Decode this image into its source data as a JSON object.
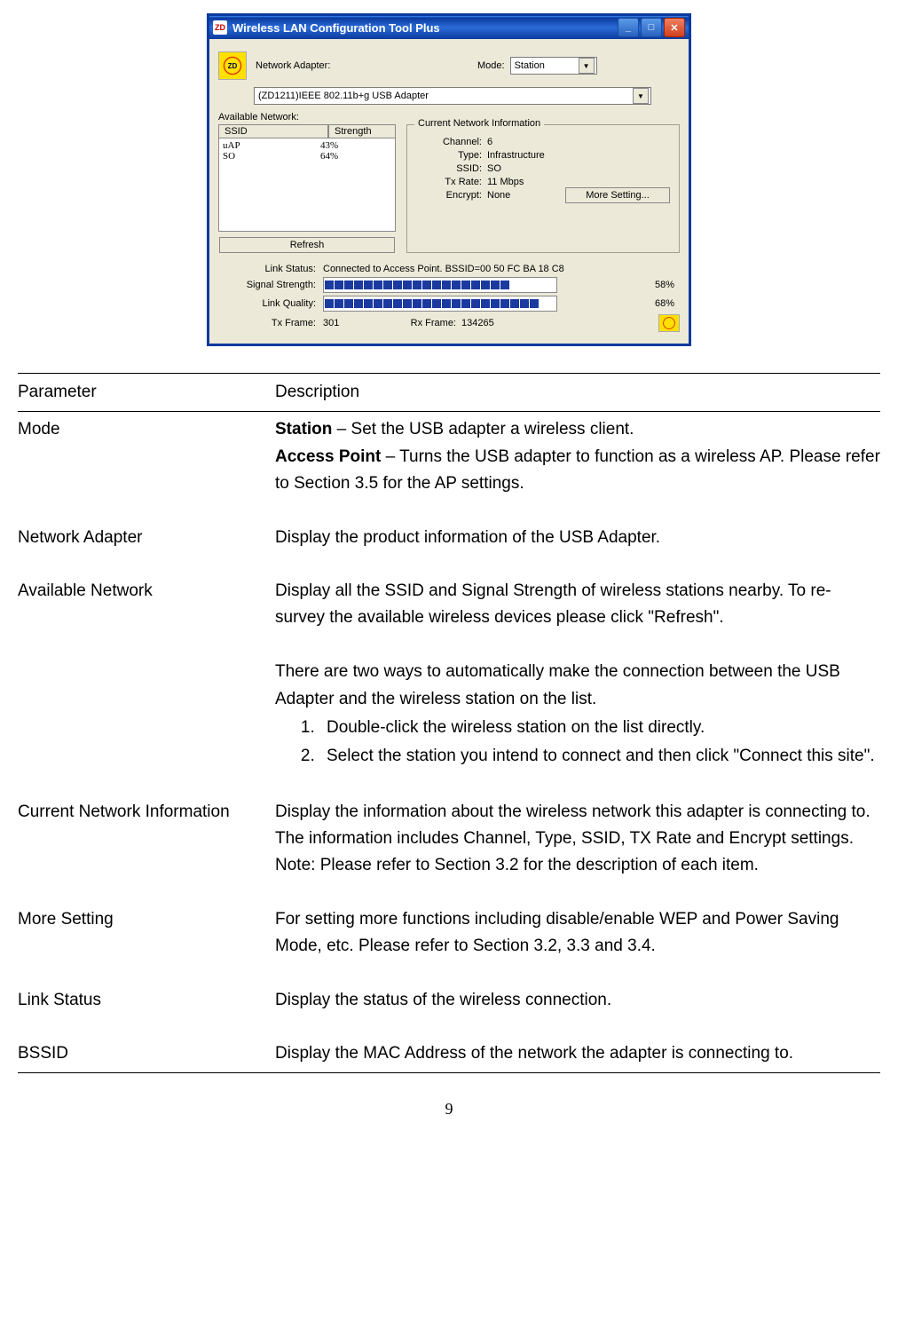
{
  "window": {
    "title": "Wireless LAN Configuration Tool Plus",
    "network_adapter_label": "Network Adapter:",
    "mode_label": "Mode:",
    "mode_value": "Station",
    "adapter_value": "(ZD1211)IEEE 802.11b+g USB Adapter",
    "available_label": "Available Network:",
    "col_ssid": "SSID",
    "col_strength": "Strength",
    "networks": [
      {
        "ssid": "uAP",
        "strength": "43%"
      },
      {
        "ssid": "SO",
        "strength": "64%"
      }
    ],
    "refresh_label": "Refresh",
    "group_legend": "Current Network Information",
    "info": {
      "channel_k": "Channel:",
      "channel_v": "6",
      "type_k": "Type:",
      "type_v": "Infrastructure",
      "ssid_k": "SSID:",
      "ssid_v": "SO",
      "txrate_k": "Tx Rate:",
      "txrate_v": "11 Mbps",
      "encrypt_k": "Encrypt:",
      "encrypt_v": "None"
    },
    "more_setting_label": "More Setting...",
    "link_status_k": "Link Status:",
    "link_status_v": "Connected to Access Point. BSSID=00 50 FC BA 18 C8",
    "signal_k": "Signal Strength:",
    "signal_pct": "58%",
    "quality_k": "Link Quality:",
    "quality_pct": "68%",
    "txframe_k": "Tx Frame:",
    "txframe_v": "301",
    "rxframe_k": "Rx Frame:",
    "rxframe_v": "134265"
  },
  "table": {
    "hdr_param": "Parameter",
    "hdr_desc": "Description",
    "rows": {
      "mode": {
        "param": "Mode",
        "b1": "Station",
        "t1": " – Set the USB adapter a wireless client.",
        "b2": "Access Point",
        "t2": " – Turns the USB adapter to function as a wireless AP. Please refer to Section 3.5 for the AP settings."
      },
      "adapter": {
        "param": "Network Adapter",
        "desc": "Display the product information of the USB Adapter."
      },
      "available": {
        "param": "Available Network",
        "p1": "Display all the SSID and Signal Strength of wireless stations nearby. To re-survey the available wireless devices please click \"Refresh\".",
        "p2": "There are two ways to automatically make the connection between the USB Adapter and the wireless station on the list.",
        "li1": "Double-click the wireless station on the list directly.",
        "li2": "Select the station you intend to connect and then click \"Connect this site\"."
      },
      "current": {
        "param": "Current Network Information",
        "desc": "Display the information about the wireless network this adapter is connecting to. The information includes Channel, Type, SSID, TX Rate and Encrypt settings. Note: Please refer to Section 3.2 for the description of each item."
      },
      "more": {
        "param": "More Setting",
        "desc": "For setting more functions including disable/enable WEP and Power Saving Mode, etc. Please refer to Section 3.2, 3.3 and 3.4."
      },
      "link": {
        "param": "Link Status",
        "desc": "Display the status of the wireless connection."
      },
      "bssid": {
        "param": "BSSID",
        "desc": "Display the MAC Address of the network the adapter is connecting to."
      }
    }
  },
  "page_number": "9"
}
